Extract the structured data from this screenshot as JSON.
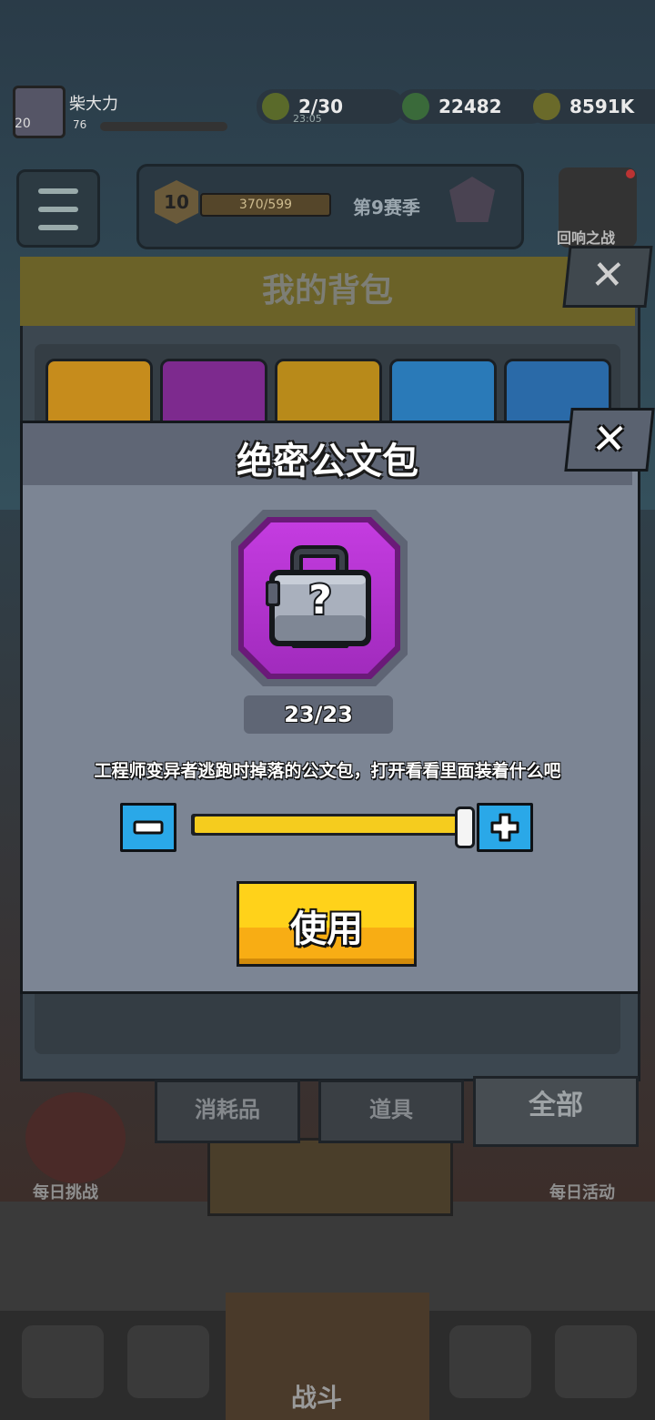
{
  "hud": {
    "player_name": "柴大力",
    "player_level": "20",
    "exp_value": "76",
    "stamina": "2/30",
    "stamina_timer": "23:05",
    "gems": "22482",
    "coins": "8591K"
  },
  "season": {
    "level": "10",
    "progress": "370/599",
    "name": "第9赛季"
  },
  "event": {
    "label": "回响之战"
  },
  "backpack": {
    "title": "我的背包",
    "close_glyph": "✕",
    "tabs": [
      "消耗品",
      "道具",
      "全部"
    ],
    "slot_colors": [
      "#c68c1c",
      "#7d2a8e",
      "#b88a1a",
      "#2a7ab8",
      "#2a6aa8"
    ]
  },
  "lower": {
    "daily_challenge": "每日挑战",
    "daily_event": "每日活动",
    "battle": "战斗"
  },
  "modal": {
    "title": "绝密公文包",
    "close_glyph": "✕",
    "item_icon": "briefcase-question-icon",
    "count": "23/23",
    "description": "工程师变异者逃跑时掉落的公文包，打开看看里面装着什么吧",
    "quantity_fraction": 1.0,
    "use_label": "使用",
    "colors": {
      "rarity": "#c43ce0",
      "slider_fill": "#f5cc1e",
      "step_button": "#2aa8e8",
      "use_button": "#ffd21a"
    }
  }
}
